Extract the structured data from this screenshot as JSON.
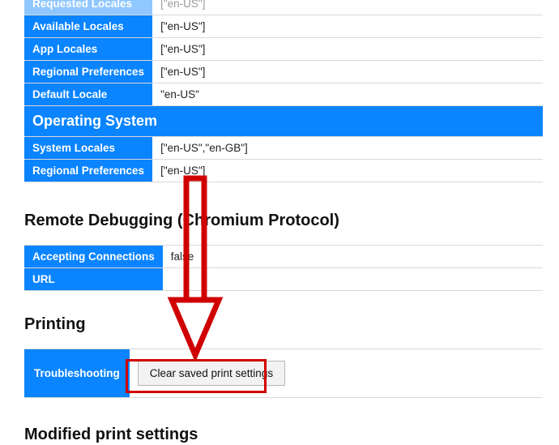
{
  "locales_table": {
    "rows": [
      {
        "field": "Requested Locales",
        "value": "[\"en-US\"]",
        "dim": true
      },
      {
        "field": "Available Locales",
        "value": "[\"en-US\"]"
      },
      {
        "field": "App Locales",
        "value": "[\"en-US\"]"
      },
      {
        "field": "Regional Preferences",
        "value": "[\"en-US\"]"
      },
      {
        "field": "Default Locale",
        "value": "\"en-US\""
      }
    ],
    "os_header": "Operating System",
    "os_rows": [
      {
        "field": "System Locales",
        "value": "[\"en-US\",\"en-GB\"]"
      },
      {
        "field": "Regional Preferences",
        "value": "[\"en-US\"]"
      }
    ]
  },
  "remote_debugging": {
    "heading": "Remote Debugging (Chromium Protocol)",
    "rows": [
      {
        "field": "Accepting Connections",
        "value": "false"
      },
      {
        "field": "URL",
        "value": ""
      }
    ]
  },
  "printing": {
    "heading": "Printing",
    "troubleshooting_label": "Troubleshooting",
    "clear_button_label": "Clear saved print settings"
  },
  "modified_print_settings_heading": "Modified print settings"
}
